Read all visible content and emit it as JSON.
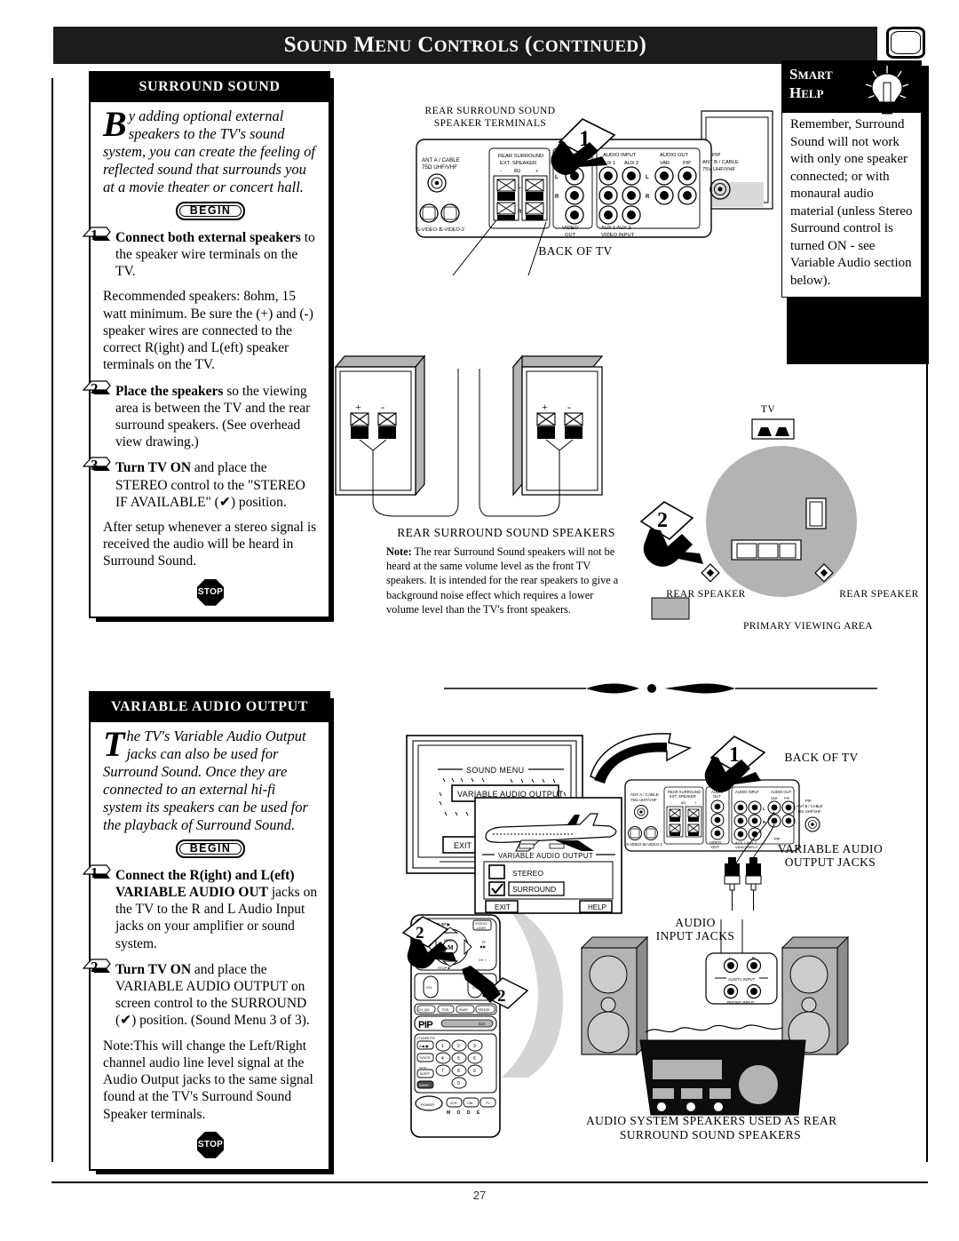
{
  "page": {
    "number": "27"
  },
  "header": {
    "title_parts": [
      "S",
      "OUND ",
      "M",
      "ENU ",
      "C",
      "ONTROLS (",
      "CONTINUED",
      ")"
    ],
    "title_plain": "SOUND MENU CONTROLS (CONTINUED)",
    "corner_icon": "tv-screen-icon"
  },
  "surround_sound": {
    "heading": "SURROUND SOUND",
    "intro_cap": "B",
    "intro": "y adding optional external speakers to the TV's sound system, you can create the feeling of reflected sound that surrounds you at a movie theater or concert hall.",
    "begin_label": "BEGIN",
    "steps": [
      {
        "num": "1",
        "bold": "Connect both external speakers",
        "rest": " to the speaker wire terminals on the TV."
      },
      {
        "num": "2",
        "bold": "Place the speakers",
        "rest": " so the viewing area is between the TV and the rear surround speakers. (See overhead view drawing.)"
      },
      {
        "num": "3",
        "bold": "Turn TV ON",
        "rest": " and place the STEREO control to the \"STEREO IF AVAILABLE\" (✔) position."
      }
    ],
    "para_after_step1": "Recommended speakers: 8ohm, 15 watt minimum. Be sure the (+) and (-) speaker wires are connected to the correct R(ight) and L(eft) speaker terminals on the TV.",
    "para_after_step3": "After setup whenever a stereo signal is received the audio will be heard in Surround Sound.",
    "stop_label": "STOP"
  },
  "variable_audio": {
    "heading": "VARIABLE AUDIO OUTPUT",
    "intro_cap": "T",
    "intro": "he TV's Variable Audio Output jacks can also be used for Surround Sound. Once they are connected to an external hi-fi system its speakers can be used for the playback of Surround Sound.",
    "begin_label": "BEGIN",
    "steps": [
      {
        "num": "1",
        "bold": "Connect the R(ight) and L(eft) VARIABLE AUDIO OUT",
        "rest": " jacks on the TV to the R and L Audio Input jacks on your amplifier or sound system."
      },
      {
        "num": "2",
        "bold": "Turn TV ON",
        "rest": " and place the VARIABLE AUDIO OUTPUT on screen control to the SURROUND (✔) position. (Sound Menu 3 of 3)."
      }
    ],
    "note": "Note:This will change the Left/Right channel audio line level signal at the Audio Output jacks to the same signal found at the TV's Surround Sound Speaker terminals.",
    "stop_label": "STOP"
  },
  "smart_help": {
    "title_line1": "SMART",
    "title_line2": "HELP",
    "title_line1_cap": "S",
    "title_line1_rest": "MART",
    "title_line2_cap": "H",
    "title_line2_rest": "ELP",
    "body": "Remember, Surround Sound will not work with only one speaker connected; or with monaural audio material (unless Stereo Surround control is turned ON - see Variable Audio section below).",
    "icon": "lightbulb-icon"
  },
  "diagram_top": {
    "label_rear_terminals_l1": "REAR  SURROUND SOUND",
    "label_rear_terminals_l2": "SPEAKER TERMINALS",
    "label_back_of_tv": "BACK OF TV",
    "callout_number": "1",
    "panel": {
      "ant_a_l1": "ANT A / CABLE",
      "ant_a_l2": "75Ω UHF/VHF",
      "svideo1": "S-VIDEO-1",
      "svideo2": "S-VIDEO-2",
      "ext_spk_l1": "REAR SURROUND",
      "ext_spk_l2": "EXT. SPEAKER",
      "ext_spk_marks": [
        "-",
        "8Ω",
        "+"
      ],
      "ext_spk_lr": [
        "L",
        "R"
      ],
      "audio_out_l1": "AUDIO",
      "audio_out_l2": "OUT",
      "video_out_l1": "VIDEO",
      "video_out_l2": "OUT",
      "audio_input": "AUDIO INPUT",
      "aux1": "AUX 1",
      "aux2": "AUX 2",
      "audio_out_grp": "AUDIO OUT",
      "var": "VAR",
      "pip": "PIP",
      "lr": [
        "L",
        "R"
      ],
      "video_input_l1": "AUX 1    AUX 2",
      "video_input_l2": "VIDEO INPUT",
      "pip_ant_l1": "PIP",
      "pip_ant_l2": "ANT B / CABLE",
      "pip_ant_l3": "75V UHF/VHF"
    }
  },
  "diagram_speakers": {
    "plus": "+",
    "minus": "-",
    "caption": "REAR SURROUND SOUND SPEAKERS",
    "note_bold": "Note:",
    "note": " The rear Surround Sound speakers will not be heard at the same volume level as the front TV speakers. It is intended for the rear speakers to give a background noise effect which requires a lower volume level than the TV's front speakers."
  },
  "diagram_overhead": {
    "tv_label": "TV",
    "callout_number": "2",
    "rear_speaker_left": "REAR  SPEAKER",
    "rear_speaker_right": "REAR  SPEAKER",
    "legend": "PRIMARY VIEWING AREA",
    "viewing_area_color": "#b3b3b3"
  },
  "diagram_bottom": {
    "callout_number_1": "1",
    "callout_number_2": "2",
    "label_back_of_tv": "BACK OF TV",
    "label_var_out_l1": "VARIABLE AUDIO",
    "label_var_out_l2": "OUTPUT JACKS",
    "label_audio_in_l1": "AUDIO",
    "label_audio_in_l2": "INPUT JACKS",
    "caption_l1": "AUDIO SYSTEM SPEAKERS USED AS REAR",
    "caption_l2": "SURROUND SOUND SPEAKERS",
    "jack_l": "L",
    "jack_r": "R",
    "aux_tv_input": "AUX/TV INPUT",
    "phono_input": "PHONO INPUT"
  },
  "tv_menu": {
    "sound_menu_title": "SOUND MENU",
    "selected_item": "VARIABLE AUDIO OUTPUT",
    "exit_label": "EXIT",
    "submenu_title": "VARIABLE AUDIO OUTPUT",
    "options": [
      {
        "label": "STEREO",
        "checked": false
      },
      {
        "label": "SURROUND",
        "checked": true
      }
    ],
    "submenu_exit": "EXIT",
    "submenu_help": "HELP"
  },
  "remote": {
    "play": "PLAY",
    "status_l1": "STATUS",
    "status_l2": "LIGHT",
    "rew": "REW",
    "ff": "FF",
    "mute": "MUTE",
    "stop": "STOP",
    "menu": "MENU",
    "vol": "VOL",
    "ch": "CH",
    "row_buttons": [
      "CH. QW",
      "POS",
      "SWAP",
      "FREEZE"
    ],
    "pip": "PIP",
    "size": "SIZE",
    "tuner": "2 TUNER PIP",
    "tv_vcr": "TV/VCR",
    "sleep": "SLEEP",
    "smart": "SMART",
    "power": "POWER",
    "mode_buttons": [
      "VCR",
      "CBL",
      "TV"
    ],
    "mode_label": "M  O  D  E",
    "keys": [
      "1",
      "2",
      "3",
      "4",
      "5",
      "6",
      "7",
      "8",
      "9",
      "0"
    ]
  }
}
